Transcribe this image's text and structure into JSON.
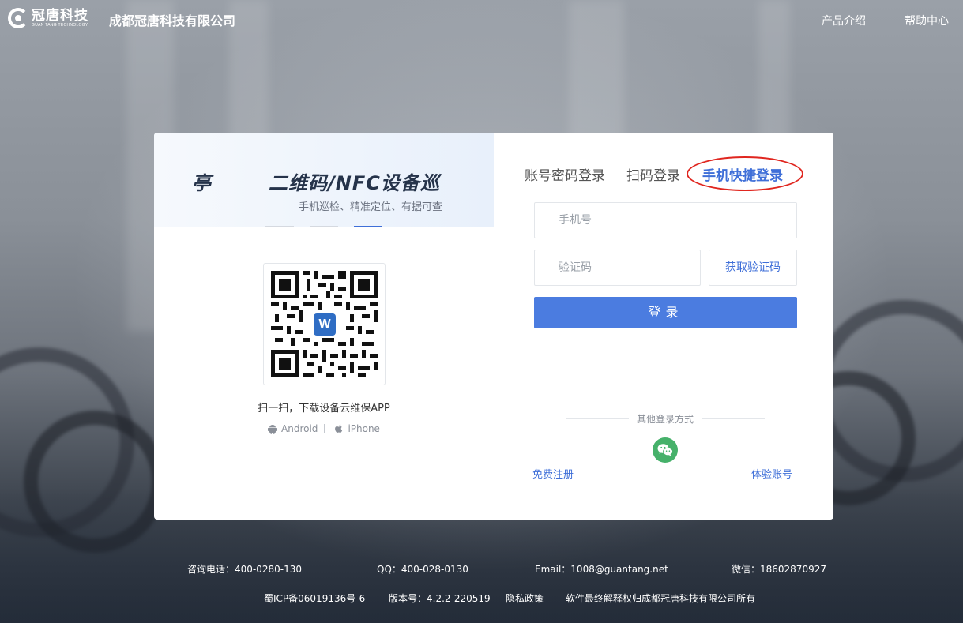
{
  "header": {
    "logo_cn": "冠唐科技",
    "logo_en": "GUAN TANG TECHNOLOGY",
    "company_name": "成都冠唐科技有限公司",
    "nav": [
      "产品介绍",
      "帮助中心"
    ]
  },
  "promo": {
    "slogan_fragment": "亭",
    "slogan": "二维码/NFC设备巡",
    "subtitle": "手机巡检、精准定位、有据可查",
    "carousel_count": 3,
    "carousel_active_index": 2,
    "qr_logo_letter": "W",
    "qr_caption": "扫一扫，下载设备云维保APP",
    "platforms": [
      "Android",
      "iPhone"
    ]
  },
  "login": {
    "tabs": [
      "账号密码登录",
      "扫码登录",
      "手机快捷登录"
    ],
    "active_tab": "手机快捷登录",
    "phone_placeholder": "手机号",
    "code_placeholder": "验证码",
    "get_code_label": "获取验证码",
    "submit_label": "登录",
    "other_methods_label": "其他登录方式",
    "register_label": "免费注册",
    "trial_label": "体验账号"
  },
  "footer": {
    "phone": "咨询电话：400-0280-130",
    "qq": "QQ：400-028-0130",
    "email": "Email：1008@guantang.net",
    "wechat": "微信：18602870927",
    "icp": "蜀ICP备06019136号-6",
    "version": "版本号：4.2.2-220519",
    "privacy": "隐私政策",
    "copyright": "软件最终解释权归成都冠唐科技有限公司所有"
  },
  "colors": {
    "accent": "#3f6fd8",
    "button": "#4b7ce0",
    "highlight_circle": "#e0261f",
    "wechat": "#46b16a"
  }
}
